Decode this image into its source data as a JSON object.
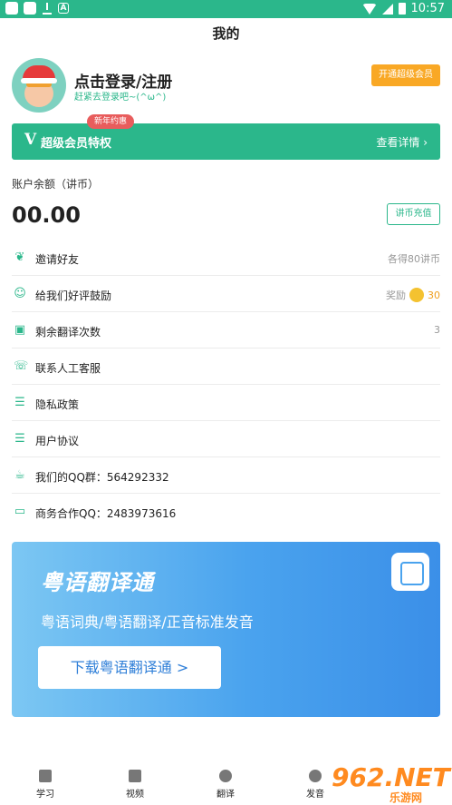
{
  "status_bar": {
    "time": "10:57",
    "notif_icons": [
      "app-icon",
      "square-icon",
      "download-icon",
      "a-icon"
    ],
    "system_icons": [
      "wifi-icon",
      "signal-icon",
      "battery-icon"
    ]
  },
  "page": {
    "title": "我的"
  },
  "profile": {
    "login_text": "点击登录/注册",
    "subtitle": "赶紧去登录吧~(^ω^)",
    "vip_button": "开通超级会员"
  },
  "vip_banner": {
    "badge": "新年约惠",
    "icon_letter": "V",
    "title": "超级会员特权",
    "details": "查看详情 ›"
  },
  "balance": {
    "label": "账户余额（讲币）",
    "value": "00.00",
    "recharge_button": "讲币充值"
  },
  "menu": [
    {
      "label": "邀请好友",
      "icon": "sprout-icon",
      "right": "各得80讲币"
    },
    {
      "label": "给我们好评鼓励",
      "icon": "people-icon",
      "right_prefix": "奖励",
      "right_value": "30"
    },
    {
      "label": "剩余翻译次数",
      "icon": "translate-count-icon",
      "right": "3"
    },
    {
      "label": "联系人工客服",
      "icon": "service-icon",
      "right": ""
    },
    {
      "label": "隐私政策",
      "icon": "list-icon",
      "right": ""
    },
    {
      "label": "用户协议",
      "icon": "list-icon",
      "right": ""
    },
    {
      "label": "我们的QQ群：564292332",
      "icon": "cup-icon",
      "right": ""
    },
    {
      "label": "商务合作QQ：2483973616",
      "icon": "briefcase-icon",
      "right": ""
    }
  ],
  "promo": {
    "title": "粤语翻译通",
    "subtitle": "粤语词典/粤语翻译/正音标准发音",
    "button": "下载粤语翻译通 >"
  },
  "tabs": [
    {
      "label": "学习"
    },
    {
      "label": "视频"
    },
    {
      "label": "翻译"
    },
    {
      "label": "发音"
    }
  ],
  "watermark": {
    "main": "962.NET",
    "sub": "乐游网"
  },
  "colors": {
    "brand_green": "#2bb78b",
    "vip_orange": "#f9a825",
    "badge_red": "#e85d5d",
    "promo_blue": "#4aa3ee",
    "coin_gold": "#f4c230"
  }
}
